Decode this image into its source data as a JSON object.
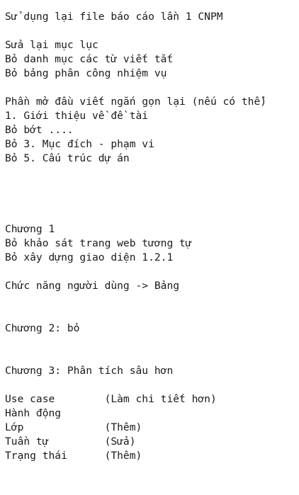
{
  "document": {
    "lines": [
      "Sử dụng lại file báo cáo lần 1 CNPM",
      "",
      "Sửa lại mục lục",
      "Bỏ danh mục các từ viết tắt",
      "Bỏ bảng phân công nhiệm vụ",
      "",
      "Phần mở đầu viết ngắn gọn lại (nếu có thể)",
      "1. Giới thiệu về đề tài",
      "Bỏ bớt ....",
      "Bỏ 3. Mục đích - phạm vi",
      "Bỏ 5. Cấu trúc dự án",
      "",
      "",
      "",
      "",
      "Chương 1",
      "Bỏ khảo sát trang web tương tự",
      "Bỏ xây dựng giao diện 1.2.1",
      "",
      "Chức năng người dùng -> Bảng",
      "",
      "",
      "Chương 2: bỏ",
      "",
      "",
      "Chương 3: Phân tích sâu hơn",
      "",
      "Use case        (Làm chi tiết hơn)",
      "Hành động",
      "Lớp             (Thêm)",
      "Tuần tự         (Sửa)",
      "Trạng thái      (Thêm)"
    ]
  }
}
